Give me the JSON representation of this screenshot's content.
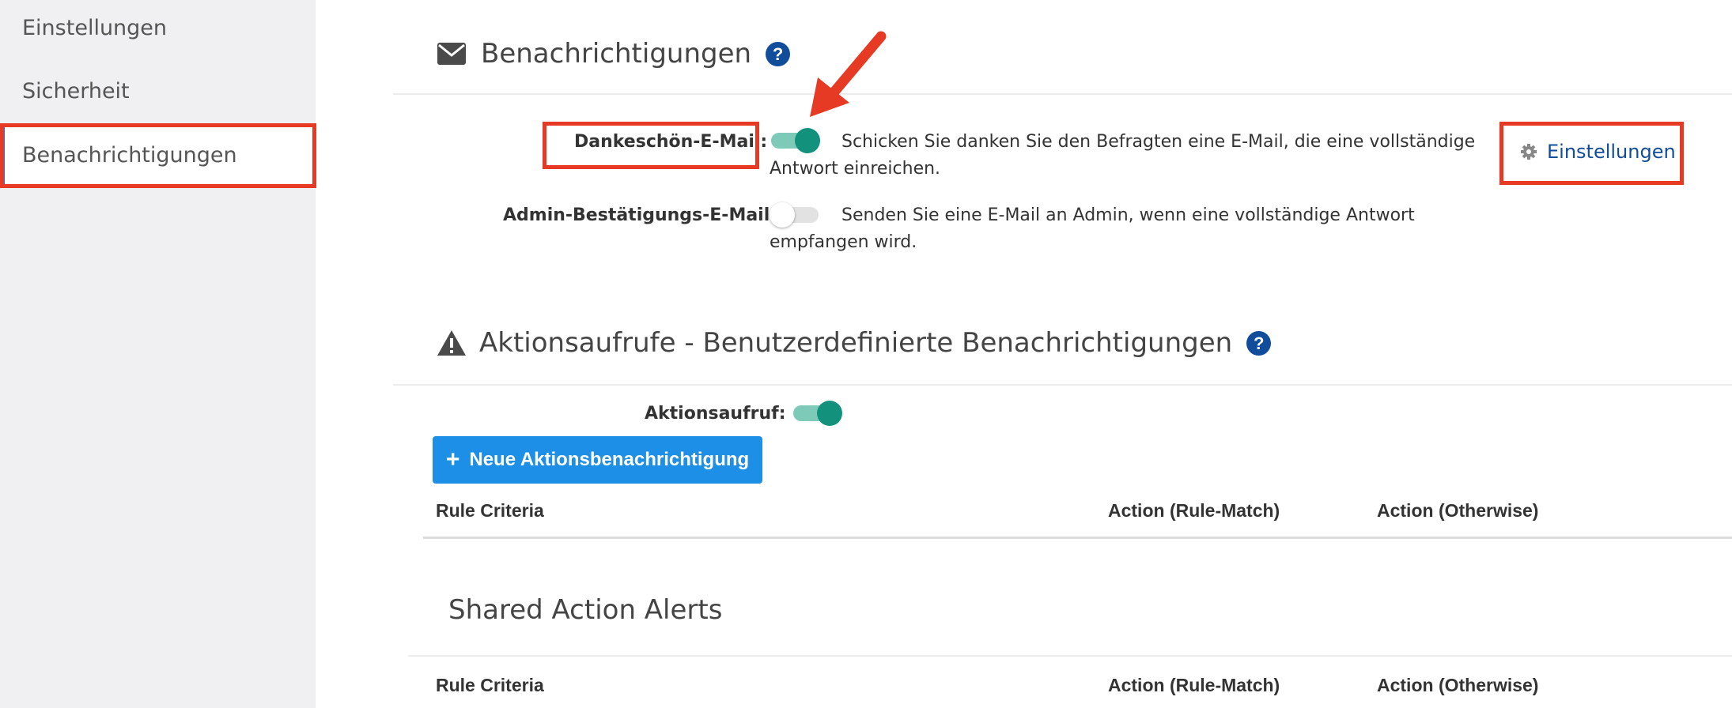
{
  "sidebar": {
    "items": [
      {
        "label": "Einstellungen"
      },
      {
        "label": "Sicherheit"
      },
      {
        "label": "Benachrichtigungen"
      }
    ]
  },
  "notifications": {
    "title": "Benachrichtigungen",
    "help": "?",
    "thank_you": {
      "label": "Dankeschön-E-Mail:",
      "enabled": true,
      "description": "Schicken Sie danken Sie den Befragten eine E-Mail, die eine vollständige Antwort einreichen."
    },
    "admin_confirm": {
      "label": "Admin-Bestätigungs-E-Mail:",
      "enabled": false,
      "description": "Senden Sie eine E-Mail an Admin, wenn eine vollständige Antwort empfangen wird."
    },
    "settings_link": "Einstellungen"
  },
  "calls_to_action": {
    "title": "Aktionsaufrufe - Benutzerdefinierte Benachrichtigungen",
    "help": "?",
    "toggle_label": "Aktionsaufruf:",
    "enabled": true,
    "new_button": "Neue Aktionsbenachrichtigung",
    "table_headers": [
      "Rule Criteria",
      "Action (Rule-Match)",
      "Action (Otherwise)"
    ]
  },
  "shared_alerts": {
    "title": "Shared Action Alerts",
    "table_headers": [
      "Rule Criteria",
      "Action (Rule-Match)",
      "Action (Otherwise)"
    ]
  },
  "colors": {
    "accent_blue": "#124d9b",
    "button_blue": "#1e8fe6",
    "toggle_on": "#12917d",
    "highlight_red": "#e63a24"
  },
  "icons": {
    "mail": "envelope-icon",
    "warning": "warning-triangle-icon",
    "gear": "gear-icon",
    "plus": "plus-icon"
  }
}
